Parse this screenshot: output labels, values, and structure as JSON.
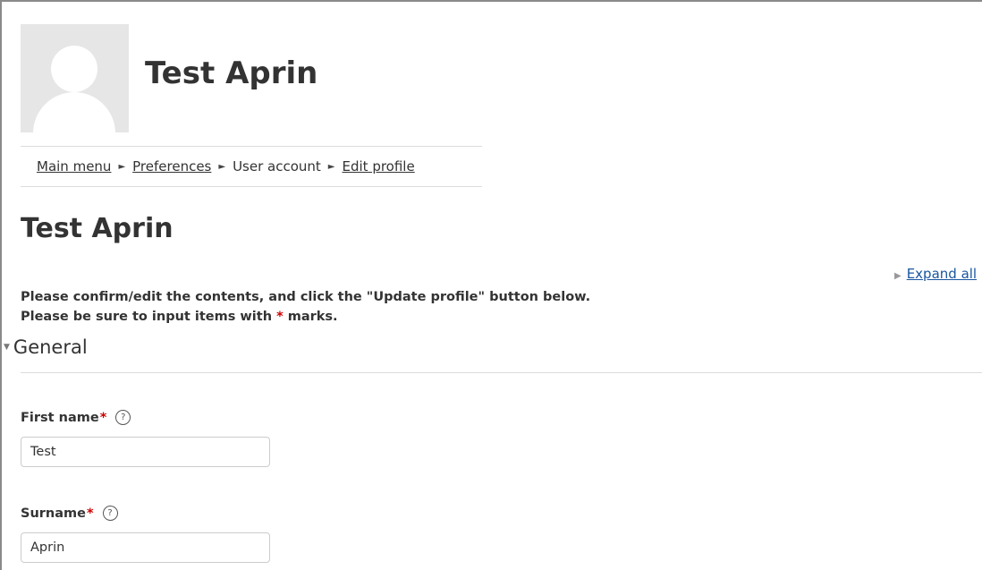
{
  "profile": {
    "name": "Test Aprin"
  },
  "breadcrumb": [
    {
      "label": "Main menu",
      "link": true
    },
    {
      "label": "Preferences",
      "link": true
    },
    {
      "label": "User account",
      "link": false
    },
    {
      "label": "Edit profile",
      "link": true
    }
  ],
  "breadcrumb_separator": "►",
  "page": {
    "heading": "Test Aprin",
    "expand_all": "Expand all",
    "instruction_1": "Please confirm/edit the contents, and click the \"Update profile\" button below.",
    "instruction_2_before": "Please be sure to input items with ",
    "instruction_2_star": "*",
    "instruction_2_after": " marks."
  },
  "section": {
    "title": "General"
  },
  "fields": {
    "first_name": {
      "label": "First name",
      "required_mark": "*",
      "value": "Test"
    },
    "surname": {
      "label": "Surname",
      "required_mark": "*",
      "value": "Aprin"
    }
  },
  "icons": {
    "help": "?",
    "expand_triangle": "▶",
    "section_caret": "▼"
  },
  "colors": {
    "link": "#1a56a0",
    "required": "#cc0000",
    "text": "#333333"
  }
}
